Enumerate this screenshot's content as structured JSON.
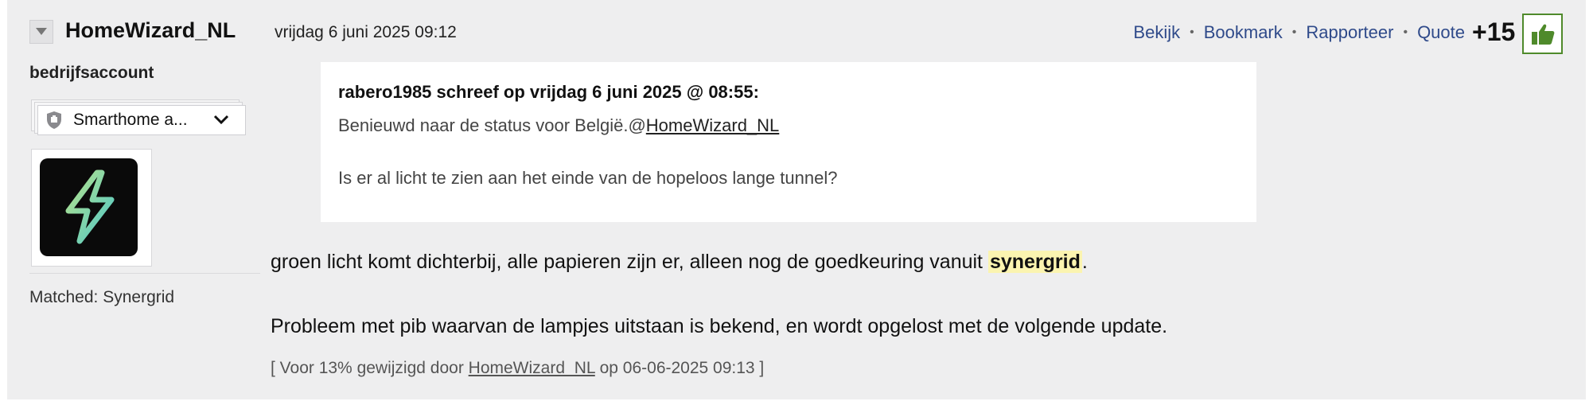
{
  "user": {
    "name": "HomeWizard_NL",
    "account_type": "bedrijfsaccount",
    "badge_label": "Smarthome a...",
    "matched": "Matched: Synergrid"
  },
  "post": {
    "timestamp": "vrijdag 6 juni 2025 09:12",
    "actions": [
      "Bekijk",
      "Bookmark",
      "Rapporteer",
      "Quote"
    ],
    "separator": "•",
    "score": "+15",
    "quote": {
      "header": "rabero1985 schreef op vrijdag 6 juni 2025 @ 08:55:",
      "line1_prefix": "Benieuwd naar de status voor België.@",
      "line1_mention": "HomeWizard_NL",
      "line2": "Is er al licht te zien aan het einde van de hopeloos lange tunnel?"
    },
    "body": {
      "p1_before": "groen licht komt dichterbij, alle papieren zijn er, alleen nog de goedkeuring vanuit ",
      "p1_highlight": "synergrid",
      "p1_after": ".",
      "p2": "Probleem met pib waarvan de lampjes uitstaan is bekend, en wordt opgelost met de volgende update."
    },
    "edit_note": {
      "prefix": "[ Voor 13% gewijzigd door ",
      "user": "HomeWizard_NL",
      "suffix": " op 06-06-2025 09:13 ]"
    }
  },
  "colors": {
    "post_bg": "#eeeeef",
    "link": "#2f4a8a",
    "thumb_green": "#4f8a2b",
    "highlight": "#fbf4b0",
    "avatar_bolt": "#7fd6b4"
  },
  "icons": {
    "collapse": "triangle-down-icon",
    "badge": "shield-icon",
    "badge_dropdown": "chevron-down-icon",
    "avatar": "lightning-bolt-icon",
    "upvote": "thumbs-up-icon"
  }
}
